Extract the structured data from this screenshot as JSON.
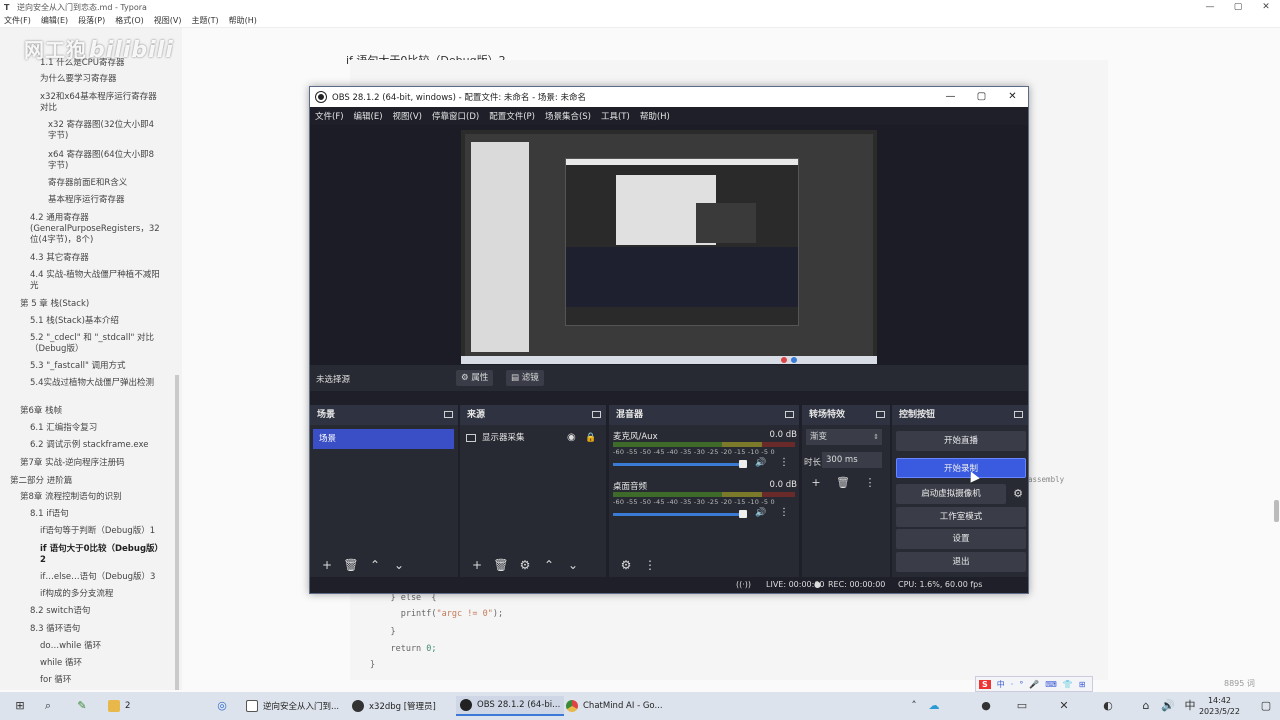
{
  "typora": {
    "title": "逆向安全从入门到恋态.md - Typora",
    "window_buttons": [
      "—",
      "▢",
      "✕"
    ],
    "menu": [
      "文件(F)",
      "编辑(E)",
      "段落(P)",
      "格式(O)",
      "视图(V)",
      "主题(T)",
      "帮助(H)"
    ],
    "outline": [
      {
        "text": "1.1 什么是CPU寄存器",
        "indent": 3
      },
      {
        "text": "为什么要学习寄存器",
        "indent": 3
      },
      {
        "text": "x32和x64基本程序运行寄存器对比",
        "indent": 3
      },
      {
        "text": "x32 寄存器图(32位大小即4字节)",
        "indent": 4
      },
      {
        "text": "x64 寄存器图(64位大小即8字节)",
        "indent": 4
      },
      {
        "text": "寄存器前面E和R含义",
        "indent": 4
      },
      {
        "text": "基本程序运行寄存器",
        "indent": 4
      },
      {
        "text": "4.2 通用寄存器(GeneralPurposeRegisters，32位(4字节)，8个)",
        "indent": 2
      },
      {
        "text": "4.3 其它寄存器",
        "indent": 2
      },
      {
        "text": "4.4 实战-植物大战僵尸种植不减阳光",
        "indent": 2
      },
      {
        "text": "第 5 章 栈(Stack)",
        "indent": 1
      },
      {
        "text": "5.1 栈(Stack)基本介绍",
        "indent": 2
      },
      {
        "text": "5.2 \"_cdecl\" 和 \"_stdcall\" 对比（Debug版）",
        "indent": 2
      },
      {
        "text": "5.3 \"_fastcall\" 调用方式",
        "indent": 2
      },
      {
        "text": "5.4实战过植物大战僵尸弹出检测",
        "indent": 2
      },
      {
        "text": "第6章 栈帧",
        "indent": 1
      },
      {
        "text": "6.1 汇编指令复习",
        "indent": 2
      },
      {
        "text": "6.2 调试示例 stackframe.exe",
        "indent": 2
      },
      {
        "text": "第7章 实战-逆向程序注册码",
        "indent": 1
      },
      {
        "text": "第二部分 进阶篇",
        "indent": 0
      },
      {
        "text": "第8章 流程控制语句的识别",
        "indent": 1
      },
      {
        "text": "8.1 if语句",
        "indent": 2
      },
      {
        "text": "if语句等于判断（Debug版）1",
        "indent": 3
      },
      {
        "text": "if 语句大于0比较（Debug版）2",
        "indent": 3,
        "active": true
      },
      {
        "text": "if…else…语句（Debug版）3",
        "indent": 3
      },
      {
        "text": "if构成的多分支流程",
        "indent": 3
      },
      {
        "text": "8.2 switch语句",
        "indent": 2
      },
      {
        "text": "8.3 循环语句",
        "indent": 2
      },
      {
        "text": "do…while 循环",
        "indent": 3
      },
      {
        "text": "while 循环",
        "indent": 3
      },
      {
        "text": "for 循环",
        "indent": 3
      }
    ],
    "footer_icons": [
      "‹",
      "</>"
    ],
    "heading": "if 语句大于0比较（Debug版）2",
    "code_fragment": "assembly",
    "code_lines": [
      {
        "pre": "    } else  {",
        "str": "",
        "post": ""
      },
      {
        "pre": "      printf(",
        "str": "\"argc != 0\"",
        "post": ");"
      },
      {
        "pre": "    }",
        "str": "",
        "post": ""
      },
      {
        "pre": "    return ",
        "str": "",
        "post": "0;"
      },
      {
        "pre": "}",
        "str": "",
        "post": ""
      }
    ],
    "word_count": "8895 词"
  },
  "watermark": {
    "text": "网工狍",
    "brand": "bilibili"
  },
  "obs": {
    "title": "OBS 28.1.2 (64-bit, windows) - 配置文件: 未命名 - 场景: 未命名",
    "window_buttons": [
      "—",
      "▢",
      "✕"
    ],
    "menu": [
      "文件(F)",
      "编辑(E)",
      "视图(V)",
      "停靠窗口(D)",
      "配置文件(P)",
      "场景集合(S)",
      "工具(T)",
      "帮助(H)"
    ],
    "source_toolbar": {
      "no_selection": "未选择源",
      "properties": "属性",
      "filters": "滤镜"
    },
    "docks": {
      "scenes": {
        "title": "场景",
        "items": [
          "场景"
        ]
      },
      "sources": {
        "title": "来源",
        "items": [
          "显示器采集"
        ]
      },
      "mixer": {
        "title": "混音器",
        "channels": [
          {
            "name": "麦克风/Aux",
            "db": "0.0 dB"
          },
          {
            "name": "桌面音频",
            "db": "0.0 dB"
          }
        ],
        "scale": "-60 -55 -50 -45 -40 -35 -30 -25 -20 -15 -10 -5 0"
      },
      "transitions": {
        "title": "转场特效",
        "selected": "渐变",
        "duration_label": "时长",
        "duration": "300 ms"
      },
      "controls": {
        "title": "控制按钮",
        "buttons": [
          "开始直播",
          "开始录制",
          "启动虚拟摄像机",
          "工作室模式",
          "设置",
          "退出"
        ]
      }
    },
    "status": {
      "live": "LIVE: 00:00:00",
      "rec": "REC: 00:00:00",
      "cpu": "CPU: 1.6%, 60.00 fps"
    }
  },
  "taskbar": {
    "apps": [
      {
        "label": "2",
        "color": "#e8b84a"
      },
      {
        "label": "逆向安全从入门到...",
        "color": "#555"
      },
      {
        "label": "x32dbg [管理员]",
        "color": "#333"
      },
      {
        "label": "OBS 28.1.2 (64-bi...",
        "color": "#222"
      },
      {
        "label": "ChatMind AI - Go...",
        "color": "#d44"
      }
    ],
    "time": "14:42",
    "date": "2023/5/22",
    "ime": [
      "S",
      "中",
      "·",
      "°",
      "🎤",
      "⌨",
      "👕",
      "⊞"
    ]
  }
}
